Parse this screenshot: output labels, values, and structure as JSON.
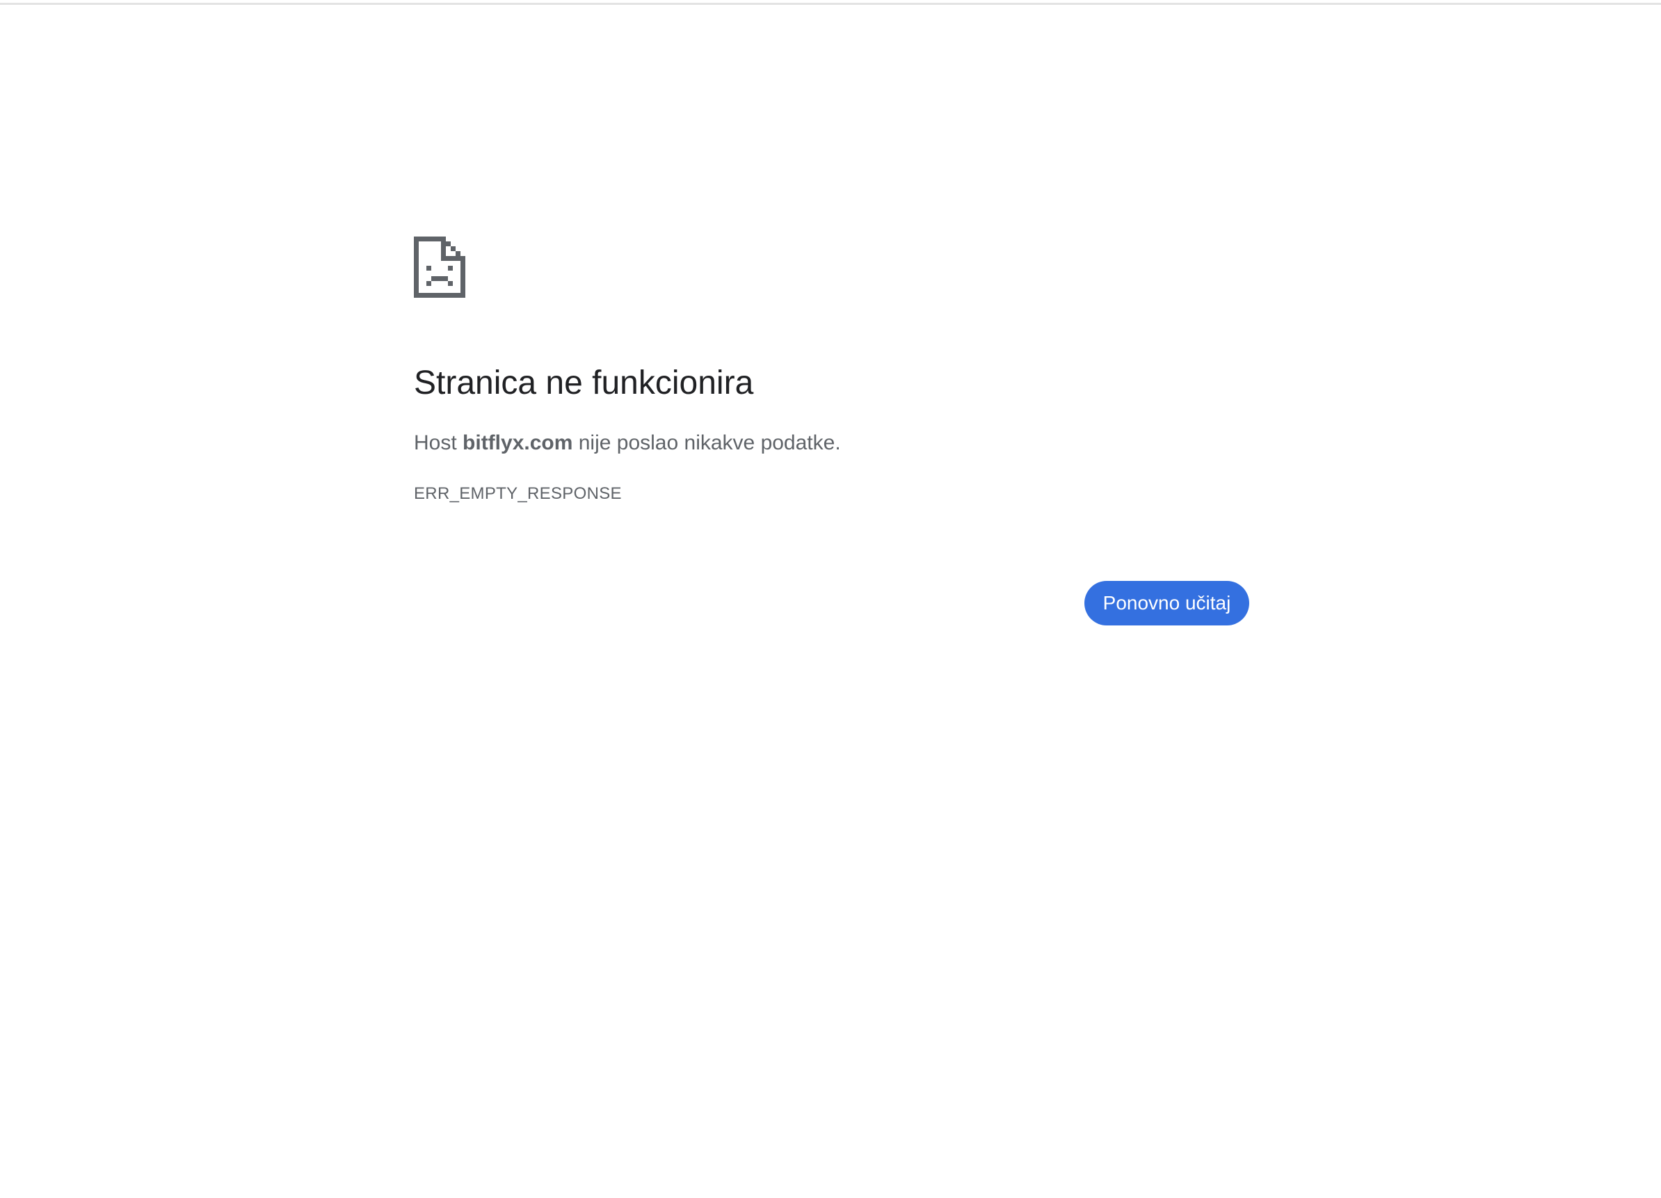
{
  "error_page": {
    "icon": "sad-document-icon",
    "title": "Stranica ne funkcionira",
    "details": {
      "prefix": "Host ",
      "host": "bitflyx.com",
      "suffix": " nije poslao nikakve podatke."
    },
    "error_code": "ERR_EMPTY_RESPONSE",
    "reload_label": "Ponovno učitaj"
  },
  "colors": {
    "title": "#202124",
    "secondary_text": "#5f6368",
    "icon": "#5f6368",
    "button_background": "#3470e0",
    "button_text": "#ffffff"
  }
}
